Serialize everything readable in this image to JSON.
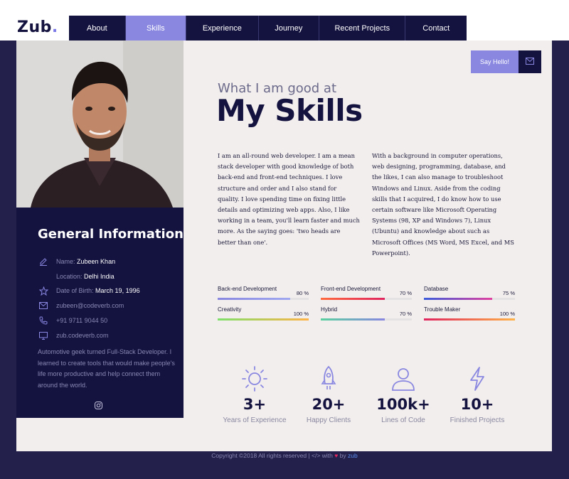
{
  "logo": {
    "text": "Zub",
    "dot": "."
  },
  "nav": {
    "items": [
      "About",
      "Skills",
      "Experience",
      "Journey",
      "Recent Projects",
      "Contact"
    ],
    "active": "Skills"
  },
  "sidebar": {
    "title": "General Information",
    "name_key": "Name:",
    "name_val": "Zubeen Khan",
    "location_key": "Location:",
    "location_val": "Delhi India",
    "dob_key": "Date of Birth:",
    "dob_val": "March 19, 1996",
    "email": "zubeen@codeverb.com",
    "phone": "+91 9711 9044 50",
    "website": "zub.codeverb.com",
    "bio": "Automotive geek turned Full-Stack Developer. I learned to create tools that would make people's life more productive and help connect them around the world."
  },
  "contact": {
    "say_hello": "Say Hello!"
  },
  "heading": {
    "subtitle": "What I am good at",
    "title": "My Skills"
  },
  "about": {
    "left": "I am an all-round web developer. I am a mean stack developer with good knowledge of both back-end and front-end techniques. I love structure and order and I also stand for quality. I love spending time on fixing little details and optimizing web apps. Also, I like working in a team, you'll learn faster and much more. As the saying goes: 'two heads are better than one'.",
    "right": "With a background in computer operations, web designing, programming, database, and the likes, I can also manage to troubleshoot Windows and Linux. Aside from the coding skills that I acquired, I do know how to use certain software like Microsoft Operating Systems (98, XP and Windows 7), Linux (Ubuntu) and knowledge about such as Microsoft Offices (MS Word, MS Excel, and MS Powerpoint)."
  },
  "skills": [
    {
      "name": "Back-end Development",
      "pct_label": "80 %",
      "value": 0.8,
      "colors": [
        "#8987e0",
        "#a0a8f0"
      ]
    },
    {
      "name": "Front-end Development",
      "pct_label": "70 %",
      "value": 0.7,
      "colors": [
        "#ff6a3d",
        "#e0245e"
      ]
    },
    {
      "name": "Database",
      "pct_label": "75 %",
      "value": 0.75,
      "colors": [
        "#3b5bdb",
        "#e040a0"
      ]
    },
    {
      "name": "Creativity",
      "pct_label": "100 %",
      "value": 1.0,
      "colors": [
        "#7ee06a",
        "#ffb347"
      ]
    },
    {
      "name": "Hybrid",
      "pct_label": "70 %",
      "value": 0.7,
      "colors": [
        "#5ad1a0",
        "#8987e0"
      ]
    },
    {
      "name": "Trouble Maker",
      "pct_label": "100 %",
      "value": 1.0,
      "colors": [
        "#e0245e",
        "#ffb347"
      ]
    }
  ],
  "stats": [
    {
      "icon": "sun-icon",
      "number": "3+",
      "label": "Years of Experience"
    },
    {
      "icon": "rocket-icon",
      "number": "20+",
      "label": "Happy Clients"
    },
    {
      "icon": "user-icon",
      "number": "100k+",
      "label": "Lines of Code"
    },
    {
      "icon": "lightning-icon",
      "number": "10+",
      "label": "Finished Projects"
    }
  ],
  "footer": {
    "text": "Copyright ©2018 All rights reserved | </> with",
    "by": "by",
    "brand": "zub"
  },
  "colors": {
    "accent": "#8987e0",
    "navy": "#14123f",
    "background": "#23214b",
    "card": "#f2eeee"
  }
}
